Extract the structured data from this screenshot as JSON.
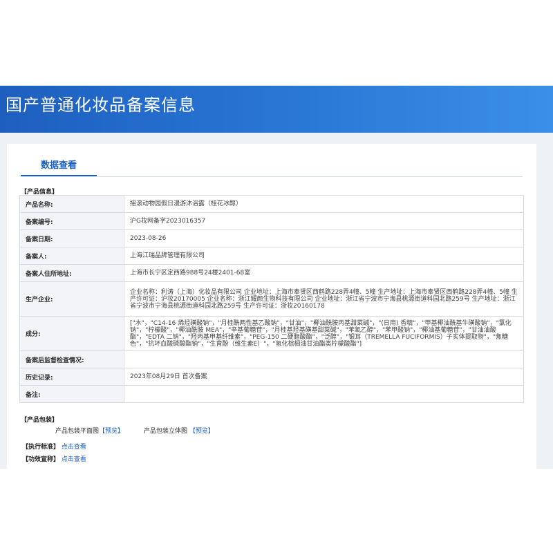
{
  "page": {
    "title": "国产普通化妆品备案信息"
  },
  "tabs": {
    "active": "数据查看"
  },
  "product_info": {
    "section_label": "【产品信息】",
    "rows": [
      {
        "label": "产品名称:",
        "value": "摇滚动物园假日漫游沐浴露（桂花冰醇）"
      },
      {
        "label": "备案编号:",
        "value": "沪G妆网备字2023016357"
      },
      {
        "label": "备案日期:",
        "value": "2023-08-26"
      },
      {
        "label": "备案人:",
        "value": "上海江瑞品牌管理有限公司"
      },
      {
        "label": "备案人住所地址:",
        "value": "上海市长宁区定西路988号24楼2401-68室"
      },
      {
        "label": "生产企业:",
        "value": "企业名称：利涛（上海）化妆品有限公司 企业地址：上海市奉贤区西鹤路228弄4幢、5幢 生产地址：上海市奉贤区西鹤路228弄4幢、5幢 生产许可证：沪妆20170005 企业名称：浙江耀颜生物科技有限公司 企业地址：浙江省宁波市宁海县桃源街道科园北路259号 生产地址：浙江省宁波市宁海县桃源街道科园北路259号 生产许可证：浙妆20160178"
      },
      {
        "label": "成分:",
        "value": "[\"水\"，\"C14-16 烯烃磺酸钠\"，\"月桂酰两性基乙酸钠\"，\"甘油\"，\"椰油酰胺丙基甜菜碱\"，\"(日用) 香精\"，\"甲基椰油酰基牛磺酸钠\"，\"氯化钠\"，\"柠檬酸\"，\"椰油酰胺 MEA\"，\"辛基葡糖苷\"，\"月桂基羟基磺基甜菜碱\"，\"苯氧乙醇\"，\"苯甲酸钠\"，\"椰油基葡糖苷\"，\"甘油油酸酯\"，\"EDTA 二钠\"，\"羟丙基甲基纤维素\"，\"PEG-150 二硬脂酸酯\"，\"泛醇\"，\"银耳（TREMELLA FUCIFORMIS）子实体提取物\"，\"焦糖色\"，\"抗坏血酸磷酸酯钠\"，\"生育酚（维生素E）\"，\"氢化棕榈油甘油酯类柠檬酸酯\"]"
      },
      {
        "label": "备案后监督检查情况:",
        "value": ""
      },
      {
        "label": "历史记录:",
        "value": "2023年08月29日 首次备案"
      },
      {
        "label": "备注:",
        "value": ""
      }
    ]
  },
  "packaging": {
    "section_label": "【产品包装】",
    "flat_label": "产品包装平面图",
    "flat_link": "【预览】",
    "stereo_label": "产品包装立体图",
    "stereo_link": "【预览】"
  },
  "standard": {
    "label": "【执行标准】",
    "link": "点击查看"
  },
  "efficacy": {
    "label": "【功效宣称】",
    "link": "点击查看"
  }
}
